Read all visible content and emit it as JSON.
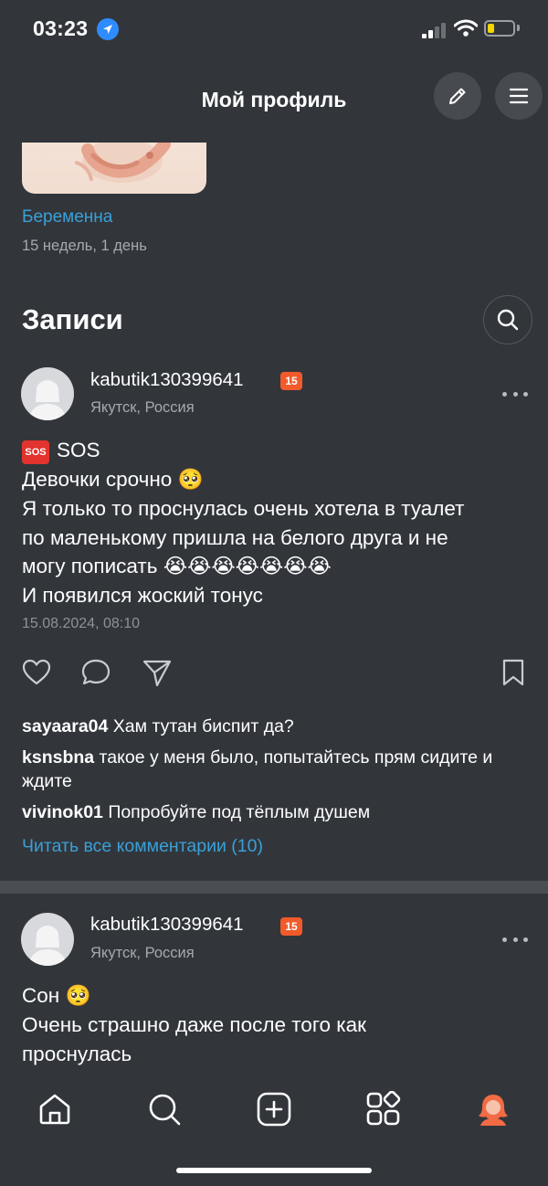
{
  "status_bar": {
    "time": "03:23"
  },
  "header": {
    "title": "Мой профиль"
  },
  "pregnancy": {
    "status": "Беременна",
    "term": "15 недель, 1 день"
  },
  "section": {
    "title": "Записи"
  },
  "posts": [
    {
      "username": "kabutik130399641",
      "badge": "15",
      "location": "Якутск, Россия",
      "lines": [
        "SOS",
        "Девочки срочно 🥺",
        "Я только то проснулась очень хотела в туалет",
        "по маленькому пришла на белого друга и не",
        "могу пописать 😭😭😭😭😭😭😭",
        "И появился жоский тонус"
      ],
      "sos_icon": "🆘",
      "timestamp": "15.08.2024, 08:10",
      "comments": [
        {
          "author": "sayaara04",
          "text": "Хам тутан биспит да?"
        },
        {
          "author": "ksnsbna",
          "text": "такое у меня было, попытайтесь прям сидите и ждите"
        },
        {
          "author": "vivinok01",
          "text": "Попробуйте под тёплым душем"
        }
      ],
      "read_all_label": "Читать все комментарии (10)"
    },
    {
      "username": "kabutik130399641",
      "badge": "15",
      "location": "Якутск, Россия",
      "lines": [
        "Сон 🥺",
        "Очень страшно даже после того как",
        "проснулась"
      ]
    }
  ],
  "colors": {
    "background": "#32363b",
    "accent_blue": "#3aa0d8",
    "badge_orange": "#f15a2a",
    "muted_text": "#a6a9ad",
    "battery_yellow": "#f5d400"
  },
  "icons": {
    "header": [
      "pencil-icon",
      "menu-icon"
    ],
    "post_actions": [
      "heart-icon",
      "comment-icon",
      "share-icon",
      "bookmark-icon"
    ],
    "tabbar": [
      "home-icon",
      "search-icon",
      "add-icon",
      "services-icon",
      "profile-icon"
    ]
  }
}
